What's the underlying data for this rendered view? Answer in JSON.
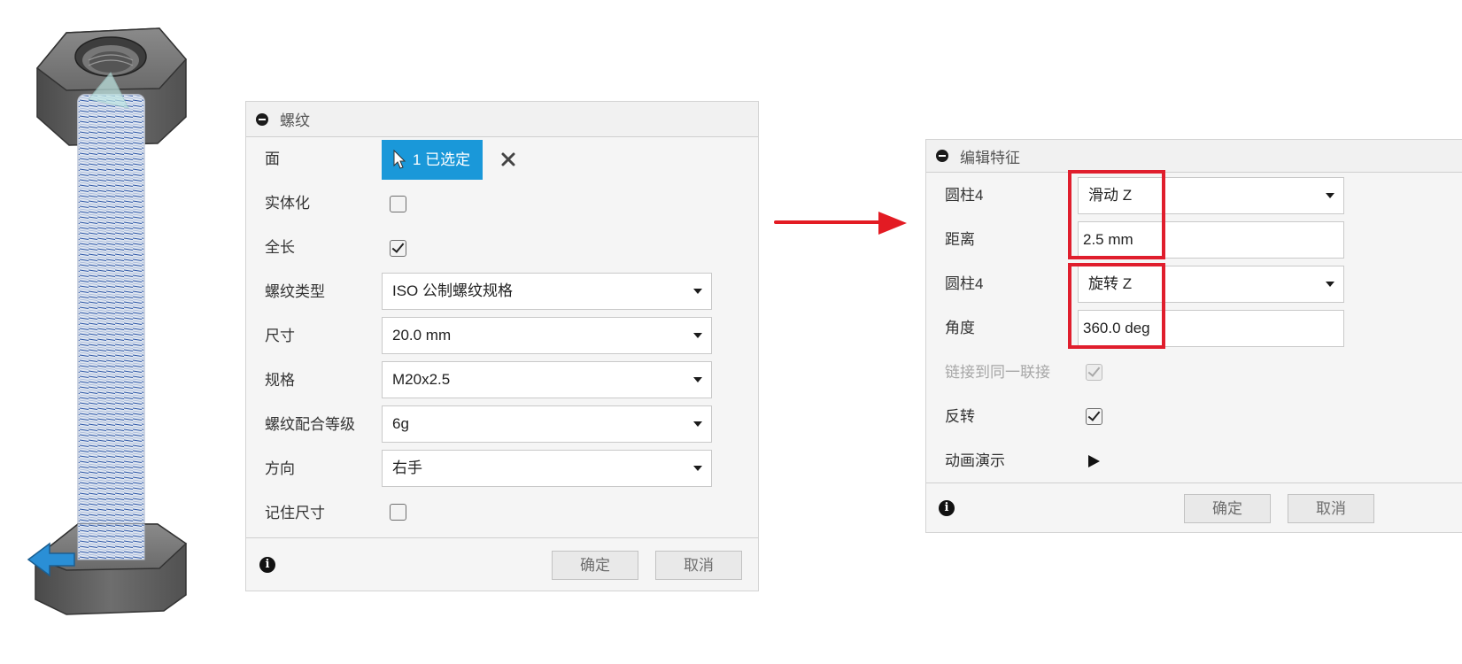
{
  "thread_dialog": {
    "title": "螺纹",
    "face": {
      "label": "面",
      "selection": "1 已选定"
    },
    "modeled": {
      "label": "实体化",
      "checked": false
    },
    "full_length": {
      "label": "全长",
      "checked": true
    },
    "thread_type": {
      "label": "螺纹类型",
      "value": "ISO 公制螺纹规格"
    },
    "size": {
      "label": "尺寸",
      "value": "20.0 mm"
    },
    "designation": {
      "label": "规格",
      "value": "M20x2.5"
    },
    "class": {
      "label": "螺纹配合等级",
      "value": "6g"
    },
    "direction": {
      "label": "方向",
      "value": "右手"
    },
    "remember_size": {
      "label": "记住尺寸",
      "checked": false
    },
    "ok_label": "确定",
    "cancel_label": "取消"
  },
  "edit_dialog": {
    "title": "编辑特征",
    "slide": {
      "label": "圆柱4",
      "value": "滑动 Z"
    },
    "distance": {
      "label": "距离",
      "value": "2.5 mm"
    },
    "rotate": {
      "label": "圆柱4",
      "value": "旋转 Z"
    },
    "angle": {
      "label": "角度",
      "value": "360.0 deg"
    },
    "link": {
      "label": "链接到同一联接",
      "checked": true,
      "disabled": true
    },
    "flip": {
      "label": "反转",
      "checked": true
    },
    "animate": {
      "label": "动画演示"
    },
    "ok_label": "确定",
    "cancel_label": "取消"
  },
  "colors": {
    "accent_blue": "#1a98d9",
    "highlight_red": "#e01e2d",
    "arrow_red": "#e31b23",
    "nut_gray": "#5e5e5e",
    "thread_blue": "#2b55a6"
  }
}
